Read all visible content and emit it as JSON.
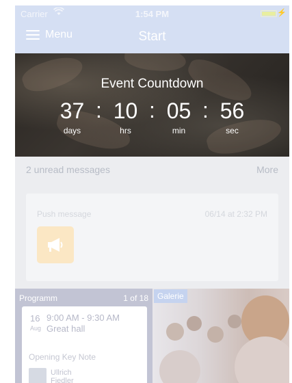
{
  "status_bar": {
    "carrier": "Carrier",
    "time": "1:54 PM"
  },
  "nav": {
    "menu_label": "Menu",
    "title": "Start"
  },
  "countdown": {
    "title": "Event Countdown",
    "units": [
      {
        "value": "37",
        "label": "days"
      },
      {
        "value": "10",
        "label": "hrs"
      },
      {
        "value": "05",
        "label": "min"
      },
      {
        "value": "56",
        "label": "sec"
      }
    ],
    "separator": ":"
  },
  "messages": {
    "count_text": "2 unread messages",
    "more_label": "More",
    "card": {
      "title": "Push message",
      "date": "06/14 at 2:32 PM",
      "icon": "megaphone-icon"
    }
  },
  "programm": {
    "label": "Programm",
    "count": "1 of 18",
    "item": {
      "day": "16",
      "month": "Aug",
      "time": "9:00 AM - 9:30 AM",
      "room": "Great hall",
      "session": "Opening Key Note",
      "speaker_first": "Ullrich",
      "speaker_last": "Fiedler"
    }
  },
  "galerie": {
    "label": "Galerie"
  },
  "colors": {
    "nav_bg": "#d5dff3",
    "programm_bg": "#c2c4d4",
    "badge_bg": "#fbe7c4",
    "screen_bg": "#ecedf0"
  }
}
